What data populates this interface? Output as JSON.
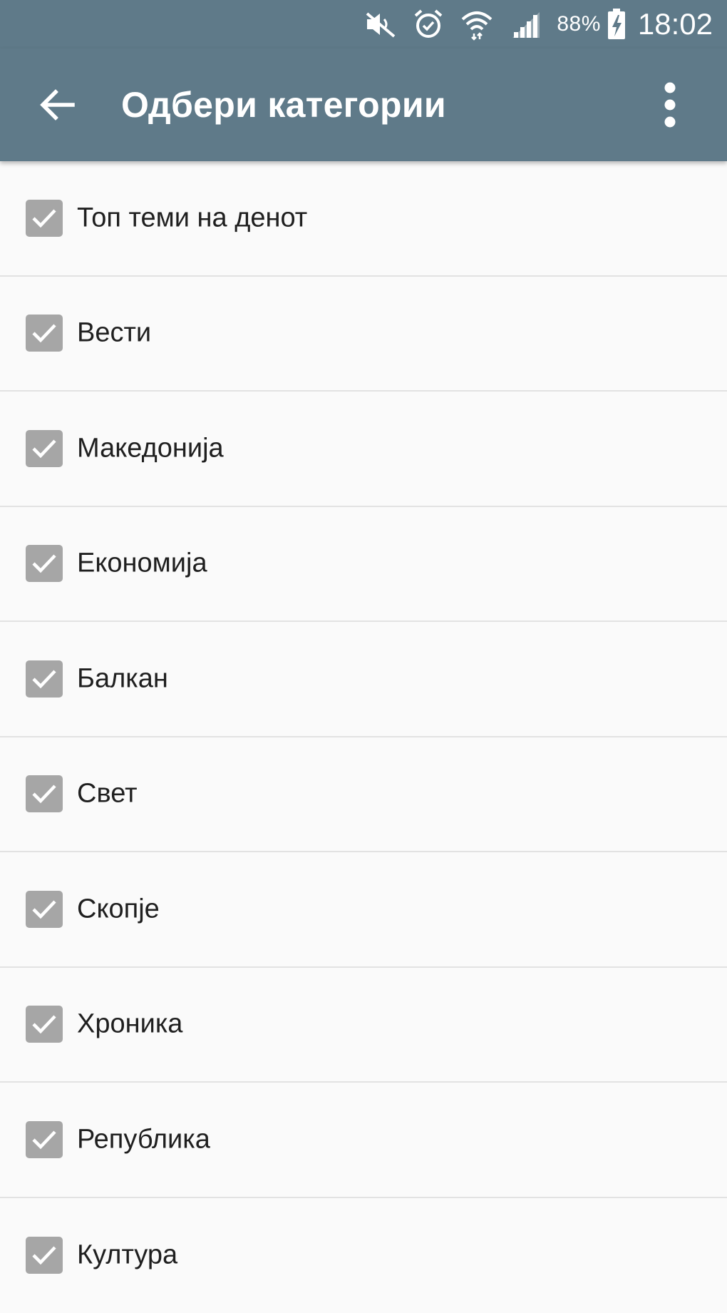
{
  "status_bar": {
    "icons": [
      "mute-icon",
      "alarm-icon",
      "wifi-icon",
      "signal-icon",
      "battery-charging-icon"
    ],
    "battery_percent": "88%",
    "time": "18:02"
  },
  "app_bar": {
    "back_icon": "arrow-left-icon",
    "title": "Одбери категории",
    "overflow_icon": "more-vert-icon"
  },
  "colors": {
    "primary": "#5f7a89",
    "checkbox": "#a6a6a6",
    "background": "#fafafa",
    "divider": "#e2e2e2"
  },
  "categories": [
    {
      "label": "Топ теми на денот",
      "checked": true
    },
    {
      "label": "Вести",
      "checked": true
    },
    {
      "label": "Македонија",
      "checked": true
    },
    {
      "label": "Економија",
      "checked": true
    },
    {
      "label": "Балкан",
      "checked": true
    },
    {
      "label": "Свет",
      "checked": true
    },
    {
      "label": "Скопје",
      "checked": true
    },
    {
      "label": "Хроника",
      "checked": true
    },
    {
      "label": "Република",
      "checked": true
    },
    {
      "label": "Култура",
      "checked": true
    }
  ]
}
